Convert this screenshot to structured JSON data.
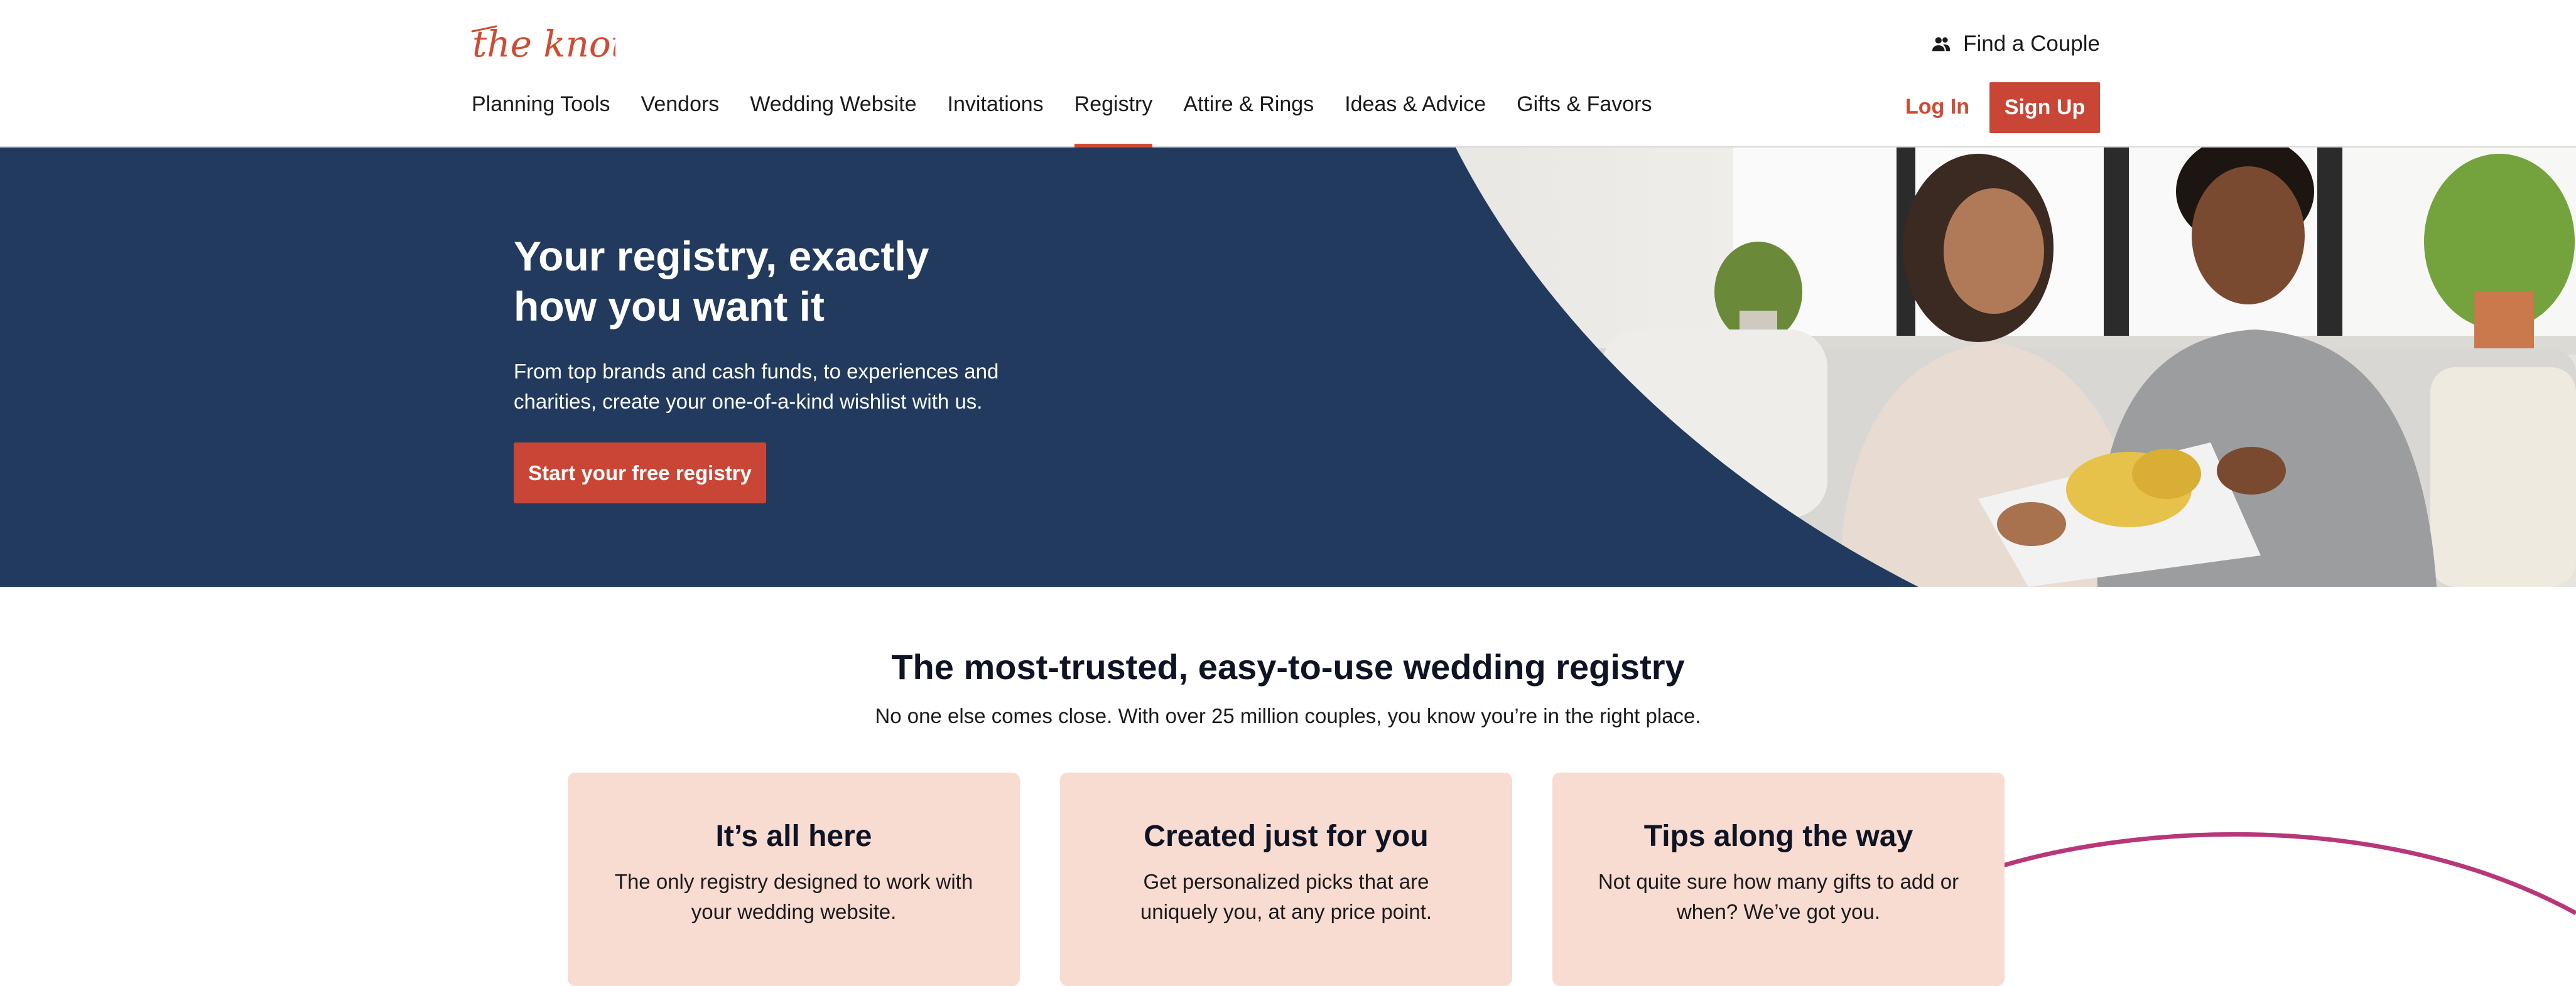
{
  "brand": {
    "logo_text": "the knot",
    "accent_color": "#d14a32",
    "hero_color": "#223a5e",
    "card_color": "#f8dbd1",
    "swoosh_color": "#b8377a"
  },
  "header": {
    "find_couple": "Find a Couple",
    "find_couple_icon": "people-icon",
    "nav": [
      {
        "label": "Planning Tools",
        "active": false
      },
      {
        "label": "Vendors",
        "active": false
      },
      {
        "label": "Wedding Website",
        "active": false
      },
      {
        "label": "Invitations",
        "active": false
      },
      {
        "label": "Registry",
        "active": true
      },
      {
        "label": "Attire & Rings",
        "active": false
      },
      {
        "label": "Ideas & Advice",
        "active": false
      },
      {
        "label": "Gifts & Favors",
        "active": false
      }
    ],
    "login": "Log In",
    "signup": "Sign Up"
  },
  "hero": {
    "title": "Your registry, exactly how you want it",
    "subtitle": "From top brands and cash funds, to experiences and charities, create your one-of-a-kind wishlist with us.",
    "cta": "Start your free registry",
    "image": "couple-opening-gift-photo"
  },
  "trusted": {
    "title": "The most-trusted, easy-to-use wedding registry",
    "subtitle": "No one else comes close. With over 25 million couples, you know you’re in the right place.",
    "cards": [
      {
        "title": "It’s all here",
        "text": "The only registry designed to work with your wedding website."
      },
      {
        "title": "Created just for you",
        "text": "Get personalized picks that are uniquely you, at any price point."
      },
      {
        "title": "Tips along the way",
        "text": "Not quite sure how many gifts to add or when? We’ve got you."
      }
    ]
  }
}
